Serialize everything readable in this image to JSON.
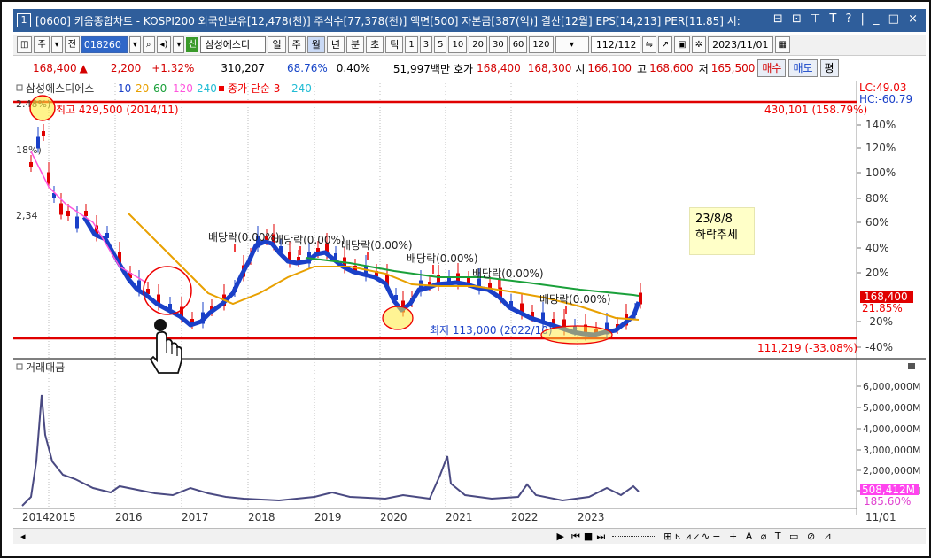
{
  "window": {
    "number": "1",
    "title": "[0600] 키움종합차트 - KOSPI200 외국인보유[12,478(천)] 주식수[77,378(천)] 액면[500] 자본금[387(억)] 결산[12월] EPS[14,213] PER[11.85] 시:",
    "buttons": "⊟ ⊡ ⊤ T ? | _ □ ×"
  },
  "toolbar": {
    "period_main": "주",
    "period_range": "전",
    "code": "018260",
    "stock_name": "삼성에스디",
    "sin_label": "신",
    "periods": [
      "일",
      "주",
      "월",
      "년",
      "분",
      "초",
      "틱"
    ],
    "selected_period": "월",
    "intervals": [
      "1",
      "3",
      "5",
      "10",
      "20",
      "30",
      "60",
      "120"
    ],
    "page": "112",
    "page_total": "/112",
    "date": "2023/11/01"
  },
  "quote": {
    "price": "168,400",
    "arrow": "▲",
    "change": "2,200",
    "change_pct": "+1.32%",
    "volume": "310,207",
    "rate1": "68.76%",
    "rate2": "0.40%",
    "amount": "51,997백만",
    "ask_label": "호가",
    "ask1": "168,400",
    "ask2": "168,300",
    "open_label": "시",
    "open": "166,100",
    "high_label": "고",
    "high": "168,600",
    "low_label": "저",
    "low": "165,500",
    "buy_btn": "매수",
    "sell_btn": "매도",
    "avg_btn": "평"
  },
  "price_pane": {
    "legend": "삼성에스디에스",
    "ma": [
      {
        "label": "10",
        "color": "#1a40c8"
      },
      {
        "label": "20",
        "color": "#e8a000"
      },
      {
        "label": "60",
        "color": "#1aa03a"
      },
      {
        "label": "120",
        "color": "#ff55dd"
      },
      {
        "label": "240",
        "color": "#22bcd4"
      }
    ],
    "ma2_label": "종가 단순 3",
    "ma2_value": "240",
    "lc": "LC:49.03",
    "hc": "HC:-60.79",
    "top_mark": "최고 429,500 (2014/11)",
    "top_right": "430,101 (158.79%)",
    "low_mark": "최저 113,000 (2022/10)",
    "low_right": "111,219 (-33.08%)",
    "left_labels": [
      "2.48%)",
      "18%)",
      "2,34"
    ],
    "y_ticks": [
      "140%",
      "120%",
      "100%",
      "80%",
      "60%",
      "40%",
      "20%",
      "-20%",
      "-40%"
    ],
    "last_price": "168,400",
    "last_pct": "21.85%",
    "dividends": [
      {
        "label": "배당락(0.00%)"
      },
      {
        "label": "배당락(0.00%)"
      },
      {
        "label": "배당락(0.00%)"
      },
      {
        "label": "배당락(0.00%)"
      },
      {
        "label": "배당락(0.00%)"
      },
      {
        "label": "배당락(0.00%)"
      }
    ],
    "note_line1": "23/8/8",
    "note_line2": "하락추세"
  },
  "volume_pane": {
    "legend": "거래대금",
    "y_ticks": [
      "6,000,000M",
      "5,000,000M",
      "4,000,000M",
      "3,000,000M",
      "2,000,000M",
      "1,000,000M"
    ],
    "last_value": "508,412M",
    "last_pct": "185.60%"
  },
  "x_axis": [
    "2014",
    "2015",
    "2016",
    "2017",
    "2018",
    "2019",
    "2020",
    "2021",
    "2022",
    "2023"
  ],
  "x_axis_right": "11/01",
  "colors": {
    "title_bar": "#2f5e9b",
    "up": "#e00000",
    "down": "#1a40c8",
    "annotation": "#e00000",
    "note_bg": "#ffffc8"
  }
}
